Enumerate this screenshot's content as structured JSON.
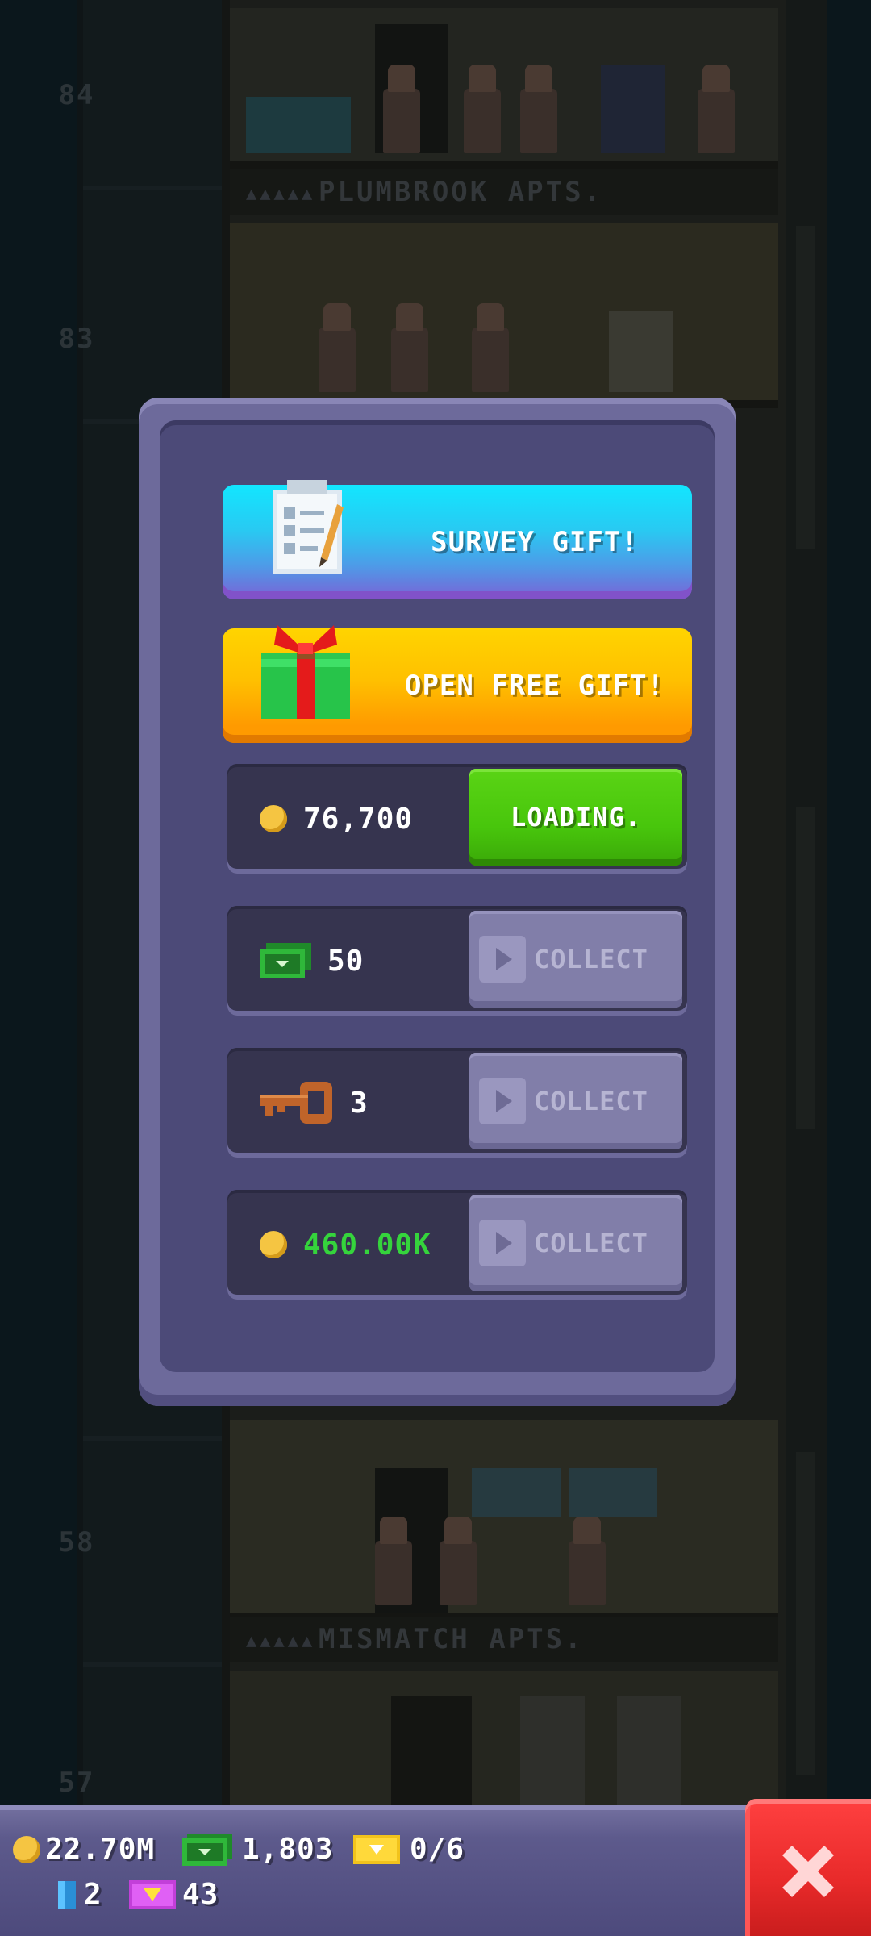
{
  "background": {
    "floors": [
      {
        "number": "84",
        "name": "PLUMBROOK APTS."
      },
      {
        "number": "83"
      },
      {
        "number": "58",
        "name": "MISMATCH APTS."
      },
      {
        "number": "57"
      }
    ]
  },
  "popup": {
    "survey_gift_label": "SURVEY GIFT!",
    "free_gift_label": "OPEN FREE GIFT!",
    "rewards": [
      {
        "icon": "coin-icon",
        "value": "76,700",
        "button": "LOADING."
      },
      {
        "icon": "cash-icon",
        "value": "50",
        "button": "COLLECT"
      },
      {
        "icon": "key-icon",
        "value": "3",
        "button": "COLLECT"
      },
      {
        "icon": "coin-icon",
        "value": "460.00K",
        "value_color": "#35d43c",
        "button": "COLLECT"
      }
    ]
  },
  "hud": {
    "coins": "22.70M",
    "bux": "1,803",
    "tickets": "0/6",
    "bits": "2",
    "vip": "43"
  },
  "colors": {
    "popup": "#6d6a9b",
    "loading_button": "#48c60c",
    "close_button": "#e82a2a"
  }
}
